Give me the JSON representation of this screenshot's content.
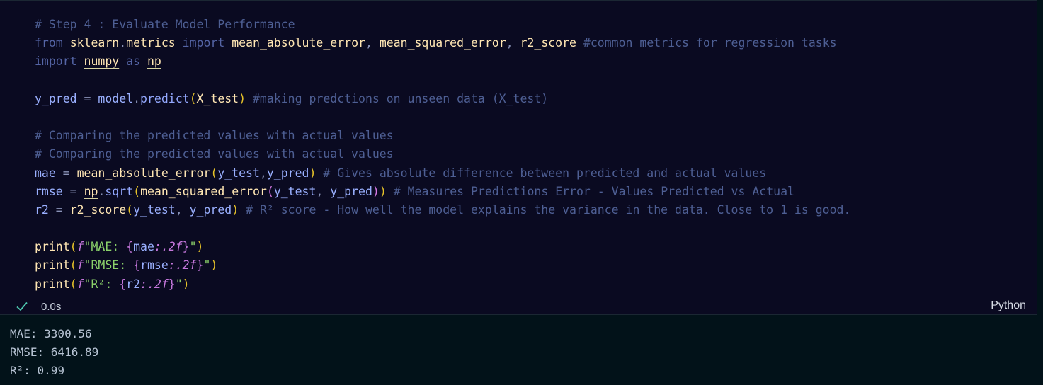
{
  "code_lines": [
    [
      {
        "t": "# Step 4 : Evaluate Model Performance",
        "c": "cm"
      }
    ],
    [
      {
        "t": "from",
        "c": "kw"
      },
      {
        "t": " ",
        "c": ""
      },
      {
        "t": "sklearn",
        "c": "mod"
      },
      {
        "t": ".",
        "c": "op"
      },
      {
        "t": "metrics",
        "c": "mod"
      },
      {
        "t": " ",
        "c": ""
      },
      {
        "t": "import",
        "c": "kw"
      },
      {
        "t": " ",
        "c": ""
      },
      {
        "t": "mean_absolute_error",
        "c": "cls"
      },
      {
        "t": ", ",
        "c": "op"
      },
      {
        "t": "mean_squared_error",
        "c": "cls"
      },
      {
        "t": ", ",
        "c": "op"
      },
      {
        "t": "r2_score",
        "c": "cls"
      },
      {
        "t": " ",
        "c": ""
      },
      {
        "t": "#common metrics for regression tasks",
        "c": "cm"
      }
    ],
    [
      {
        "t": "import",
        "c": "kw"
      },
      {
        "t": " ",
        "c": ""
      },
      {
        "t": "numpy",
        "c": "mod"
      },
      {
        "t": " ",
        "c": ""
      },
      {
        "t": "as",
        "c": "kw"
      },
      {
        "t": " ",
        "c": ""
      },
      {
        "t": "np",
        "c": "mod"
      }
    ],
    [],
    [
      {
        "t": "y_pred",
        "c": "var"
      },
      {
        "t": " = ",
        "c": "op"
      },
      {
        "t": "model",
        "c": "var"
      },
      {
        "t": ".",
        "c": "op"
      },
      {
        "t": "predict",
        "c": "fn"
      },
      {
        "t": "(",
        "c": "p1"
      },
      {
        "t": "X_test",
        "c": "cls"
      },
      {
        "t": ")",
        "c": "p1"
      },
      {
        "t": " ",
        "c": ""
      },
      {
        "t": "#making predctions on unseen data (X_test)",
        "c": "cm"
      }
    ],
    [],
    [
      {
        "t": "# Comparing the predicted values with actual values",
        "c": "cm"
      }
    ],
    [
      {
        "t": "# Comparing the predicted values with actual values",
        "c": "cm"
      }
    ],
    [
      {
        "t": "mae",
        "c": "var"
      },
      {
        "t": " = ",
        "c": "op"
      },
      {
        "t": "mean_absolute_error",
        "c": "cls"
      },
      {
        "t": "(",
        "c": "p1"
      },
      {
        "t": "y_test",
        "c": "var"
      },
      {
        "t": ",",
        "c": "op"
      },
      {
        "t": "y_pred",
        "c": "var"
      },
      {
        "t": ")",
        "c": "p1"
      },
      {
        "t": " ",
        "c": ""
      },
      {
        "t": "# Gives absolute difference between predicted and actual values",
        "c": "cm"
      }
    ],
    [
      {
        "t": "rmse",
        "c": "var"
      },
      {
        "t": " = ",
        "c": "op"
      },
      {
        "t": "np",
        "c": "mod"
      },
      {
        "t": ".",
        "c": "op"
      },
      {
        "t": "sqrt",
        "c": "fn"
      },
      {
        "t": "(",
        "c": "p1"
      },
      {
        "t": "mean_squared_error",
        "c": "cls"
      },
      {
        "t": "(",
        "c": "p2"
      },
      {
        "t": "y_test",
        "c": "var"
      },
      {
        "t": ", ",
        "c": "op"
      },
      {
        "t": "y_pred",
        "c": "var"
      },
      {
        "t": ")",
        "c": "p2"
      },
      {
        "t": ")",
        "c": "p1"
      },
      {
        "t": " ",
        "c": ""
      },
      {
        "t": "# Measures Predictions Error - Values Predicted vs Actual",
        "c": "cm"
      }
    ],
    [
      {
        "t": "r2",
        "c": "var"
      },
      {
        "t": " = ",
        "c": "op"
      },
      {
        "t": "r2_score",
        "c": "cls"
      },
      {
        "t": "(",
        "c": "p1"
      },
      {
        "t": "y_test",
        "c": "var"
      },
      {
        "t": ", ",
        "c": "op"
      },
      {
        "t": "y_pred",
        "c": "var"
      },
      {
        "t": ")",
        "c": "p1"
      },
      {
        "t": " ",
        "c": ""
      },
      {
        "t": "# R² score - How well the model explains the variance in the data. Close to 1 is good.",
        "c": "cm"
      }
    ],
    [],
    [
      {
        "t": "print",
        "c": "cls"
      },
      {
        "t": "(",
        "c": "p1"
      },
      {
        "t": "f",
        "c": "fstr"
      },
      {
        "t": "\"MAE: ",
        "c": "str"
      },
      {
        "t": "{",
        "c": "brace"
      },
      {
        "t": "mae",
        "c": "var"
      },
      {
        "t": ":.2f",
        "c": "fmt"
      },
      {
        "t": "}",
        "c": "brace"
      },
      {
        "t": "\"",
        "c": "str"
      },
      {
        "t": ")",
        "c": "p1"
      }
    ],
    [
      {
        "t": "print",
        "c": "cls"
      },
      {
        "t": "(",
        "c": "p1"
      },
      {
        "t": "f",
        "c": "fstr"
      },
      {
        "t": "\"RMSE: ",
        "c": "str"
      },
      {
        "t": "{",
        "c": "brace"
      },
      {
        "t": "rmse",
        "c": "var"
      },
      {
        "t": ":.2f",
        "c": "fmt"
      },
      {
        "t": "}",
        "c": "brace"
      },
      {
        "t": "\"",
        "c": "str"
      },
      {
        "t": ")",
        "c": "p1"
      }
    ],
    [
      {
        "t": "print",
        "c": "cls"
      },
      {
        "t": "(",
        "c": "p1"
      },
      {
        "t": "f",
        "c": "fstr"
      },
      {
        "t": "\"R²: ",
        "c": "str"
      },
      {
        "t": "{",
        "c": "brace"
      },
      {
        "t": "r2",
        "c": "var"
      },
      {
        "t": ":.2f",
        "c": "fmt"
      },
      {
        "t": "}",
        "c": "brace"
      },
      {
        "t": "\"",
        "c": "str"
      },
      {
        "t": ")",
        "c": "p1"
      }
    ]
  ],
  "status": {
    "icon": "check-icon",
    "duration": "0.0s",
    "language": "Python"
  },
  "output_lines": [
    "MAE: 3300.56",
    "RMSE: 6416.89",
    "R²: 0.99"
  ],
  "colors": {
    "cell_bg": "#0a0a21",
    "page_bg": "#021219",
    "check": "#4ec9b0"
  }
}
